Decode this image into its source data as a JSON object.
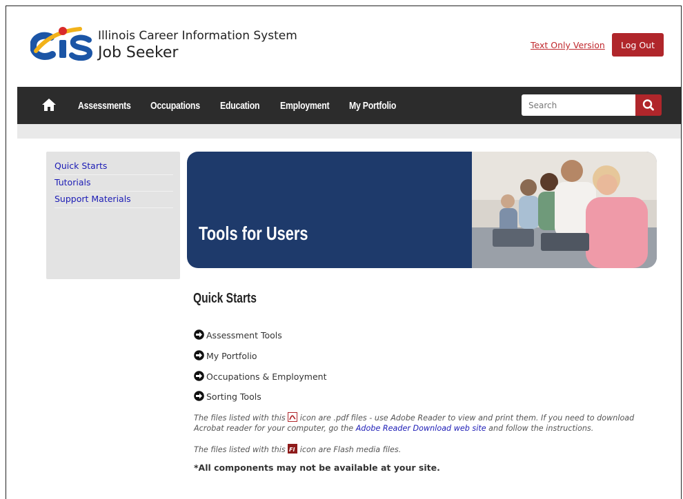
{
  "header": {
    "logo_title": "Illinois Career Information System",
    "logo_subtitle": "Job Seeker",
    "text_only_link": "Text Only Version",
    "logout_label": "Log Out"
  },
  "nav": {
    "home_icon": "home-icon",
    "items": [
      "Assessments",
      "Occupations",
      "Education",
      "Employment",
      "My Portfolio"
    ],
    "search_placeholder": "Search",
    "search_icon": "search-icon"
  },
  "sidebar": {
    "items": [
      "Quick Starts",
      "Tutorials",
      "Support Materials"
    ]
  },
  "banner": {
    "title": "Tools for Users"
  },
  "main": {
    "section_title": "Quick Starts",
    "items": [
      "Assessment Tools",
      "My Portfolio",
      "Occupations & Employment",
      "Sorting Tools"
    ],
    "pdf_note_prefix": "The files listed with this",
    "pdf_note_middle": "icon are .pdf files - use Adobe Reader to view and print them. If you need to download Acrobat reader for your computer, go the",
    "pdf_note_link": "Adobe Reader Download web site",
    "pdf_note_suffix": "and follow the instructions.",
    "flash_note_prefix": "The files listed with this",
    "flash_note_suffix": "icon are Flash media files.",
    "disclaimer": "*All components may not be available at your site."
  },
  "colors": {
    "brand_red": "#b0262b",
    "nav_bg": "#2c2c2c",
    "banner_blue": "#1e3a6b",
    "link_blue": "#1b1bb5"
  }
}
